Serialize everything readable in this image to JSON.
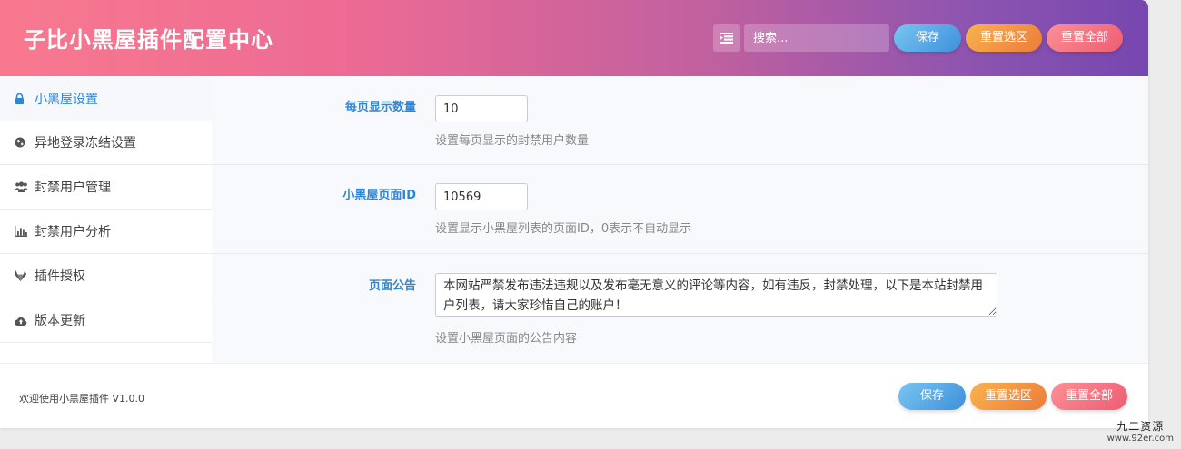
{
  "header": {
    "title": "子比小黑屋插件配置中心",
    "search_placeholder": "搜索...",
    "save_label": "保存",
    "reset_selection_label": "重置选区",
    "reset_all_label": "重置全部"
  },
  "sidebar": {
    "items": [
      {
        "label": "小黑屋设置",
        "icon": "lock-icon"
      },
      {
        "label": "异地登录冻结设置",
        "icon": "globe-icon"
      },
      {
        "label": "封禁用户管理",
        "icon": "users-icon"
      },
      {
        "label": "封禁用户分析",
        "icon": "bar-chart-icon"
      },
      {
        "label": "插件授权",
        "icon": "gitlab-icon"
      },
      {
        "label": "版本更新",
        "icon": "cloud-upload-icon"
      }
    ]
  },
  "settings": {
    "per_page": {
      "label": "每页显示数量",
      "value": "10",
      "help": "设置每页显示的封禁用户数量"
    },
    "page_id": {
      "label": "小黑屋页面ID",
      "value": "10569",
      "help": "设置显示小黑屋列表的页面ID，0表示不自动显示"
    },
    "notice": {
      "label": "页面公告",
      "value": "本网站严禁发布违法违规以及发布毫无意义的评论等内容，如有违反，封禁处理，以下是本站封禁用户列表，请大家珍惜自己的账户！",
      "help": "设置小黑屋页面的公告内容"
    }
  },
  "footer": {
    "text": "欢迎使用小黑屋插件 V1.0.0",
    "save_label": "保存",
    "reset_selection_label": "重置选区",
    "reset_all_label": "重置全部"
  },
  "watermark": {
    "top": "九二资源",
    "bottom": "www.92er.com"
  },
  "colors": {
    "accent": "#2f86d4",
    "header_gradient_start": "#f8798f",
    "header_gradient_end": "#7647b0",
    "save_button": "#3f8fdc",
    "reset_selection_button": "#ec7c3a",
    "reset_all_button": "#ee5d72"
  }
}
